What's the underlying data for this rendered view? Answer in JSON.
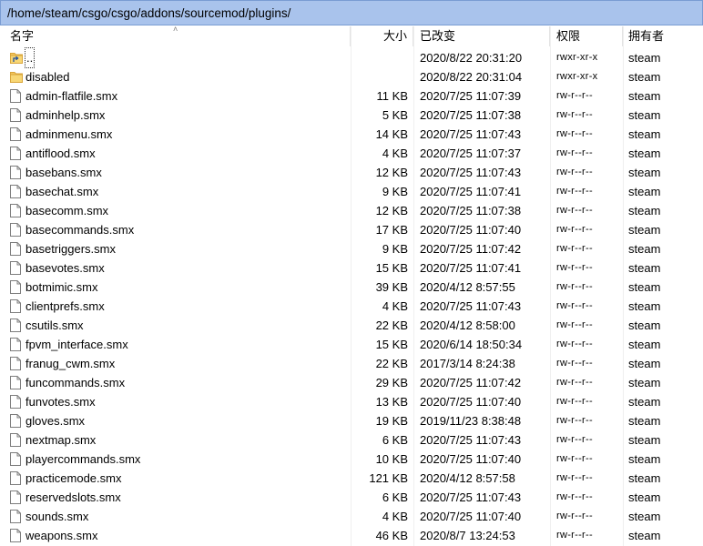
{
  "path": "/home/steam/csgo/csgo/addons/sourcemod/plugins/",
  "columns": {
    "name": "名字",
    "size": "大小",
    "modified": "已改变",
    "permissions": "权限",
    "owner": "拥有者"
  },
  "rows": [
    {
      "type": "up",
      "name": "..",
      "size": "",
      "modified": "2020/8/22 20:31:20",
      "permissions": "rwxr-xr-x",
      "owner": "steam"
    },
    {
      "type": "folder",
      "name": "disabled",
      "size": "",
      "modified": "2020/8/22 20:31:04",
      "permissions": "rwxr-xr-x",
      "owner": "steam"
    },
    {
      "type": "file",
      "name": "admin-flatfile.smx",
      "size": "11 KB",
      "modified": "2020/7/25 11:07:39",
      "permissions": "rw-r--r--",
      "owner": "steam"
    },
    {
      "type": "file",
      "name": "adminhelp.smx",
      "size": "5 KB",
      "modified": "2020/7/25 11:07:38",
      "permissions": "rw-r--r--",
      "owner": "steam"
    },
    {
      "type": "file",
      "name": "adminmenu.smx",
      "size": "14 KB",
      "modified": "2020/7/25 11:07:43",
      "permissions": "rw-r--r--",
      "owner": "steam"
    },
    {
      "type": "file",
      "name": "antiflood.smx",
      "size": "4 KB",
      "modified": "2020/7/25 11:07:37",
      "permissions": "rw-r--r--",
      "owner": "steam"
    },
    {
      "type": "file",
      "name": "basebans.smx",
      "size": "12 KB",
      "modified": "2020/7/25 11:07:43",
      "permissions": "rw-r--r--",
      "owner": "steam"
    },
    {
      "type": "file",
      "name": "basechat.smx",
      "size": "9 KB",
      "modified": "2020/7/25 11:07:41",
      "permissions": "rw-r--r--",
      "owner": "steam"
    },
    {
      "type": "file",
      "name": "basecomm.smx",
      "size": "12 KB",
      "modified": "2020/7/25 11:07:38",
      "permissions": "rw-r--r--",
      "owner": "steam"
    },
    {
      "type": "file",
      "name": "basecommands.smx",
      "size": "17 KB",
      "modified": "2020/7/25 11:07:40",
      "permissions": "rw-r--r--",
      "owner": "steam"
    },
    {
      "type": "file",
      "name": "basetriggers.smx",
      "size": "9 KB",
      "modified": "2020/7/25 11:07:42",
      "permissions": "rw-r--r--",
      "owner": "steam"
    },
    {
      "type": "file",
      "name": "basevotes.smx",
      "size": "15 KB",
      "modified": "2020/7/25 11:07:41",
      "permissions": "rw-r--r--",
      "owner": "steam"
    },
    {
      "type": "file",
      "name": "botmimic.smx",
      "size": "39 KB",
      "modified": "2020/4/12 8:57:55",
      "permissions": "rw-r--r--",
      "owner": "steam"
    },
    {
      "type": "file",
      "name": "clientprefs.smx",
      "size": "4 KB",
      "modified": "2020/7/25 11:07:43",
      "permissions": "rw-r--r--",
      "owner": "steam"
    },
    {
      "type": "file",
      "name": "csutils.smx",
      "size": "22 KB",
      "modified": "2020/4/12 8:58:00",
      "permissions": "rw-r--r--",
      "owner": "steam"
    },
    {
      "type": "file",
      "name": "fpvm_interface.smx",
      "size": "15 KB",
      "modified": "2020/6/14 18:50:34",
      "permissions": "rw-r--r--",
      "owner": "steam"
    },
    {
      "type": "file",
      "name": "franug_cwm.smx",
      "size": "22 KB",
      "modified": "2017/3/14 8:24:38",
      "permissions": "rw-r--r--",
      "owner": "steam"
    },
    {
      "type": "file",
      "name": "funcommands.smx",
      "size": "29 KB",
      "modified": "2020/7/25 11:07:42",
      "permissions": "rw-r--r--",
      "owner": "steam"
    },
    {
      "type": "file",
      "name": "funvotes.smx",
      "size": "13 KB",
      "modified": "2020/7/25 11:07:40",
      "permissions": "rw-r--r--",
      "owner": "steam"
    },
    {
      "type": "file",
      "name": "gloves.smx",
      "size": "19 KB",
      "modified": "2019/11/23 8:38:48",
      "permissions": "rw-r--r--",
      "owner": "steam"
    },
    {
      "type": "file",
      "name": "nextmap.smx",
      "size": "6 KB",
      "modified": "2020/7/25 11:07:43",
      "permissions": "rw-r--r--",
      "owner": "steam"
    },
    {
      "type": "file",
      "name": "playercommands.smx",
      "size": "10 KB",
      "modified": "2020/7/25 11:07:40",
      "permissions": "rw-r--r--",
      "owner": "steam"
    },
    {
      "type": "file",
      "name": "practicemode.smx",
      "size": "121 KB",
      "modified": "2020/4/12 8:57:58",
      "permissions": "rw-r--r--",
      "owner": "steam"
    },
    {
      "type": "file",
      "name": "reservedslots.smx",
      "size": "6 KB",
      "modified": "2020/7/25 11:07:43",
      "permissions": "rw-r--r--",
      "owner": "steam"
    },
    {
      "type": "file",
      "name": "sounds.smx",
      "size": "4 KB",
      "modified": "2020/7/25 11:07:40",
      "permissions": "rw-r--r--",
      "owner": "steam"
    },
    {
      "type": "file",
      "name": "weapons.smx",
      "size": "46 KB",
      "modified": "2020/8/7 13:24:53",
      "permissions": "rw-r--r--",
      "owner": "steam"
    }
  ],
  "icons": {
    "file": "file-icon",
    "folder": "folder-icon",
    "up": "parent-folder-icon",
    "sort": "sort-ascending-icon"
  },
  "colors": {
    "path_bar": "#a9c3ec",
    "folder": "#f2c55c"
  }
}
